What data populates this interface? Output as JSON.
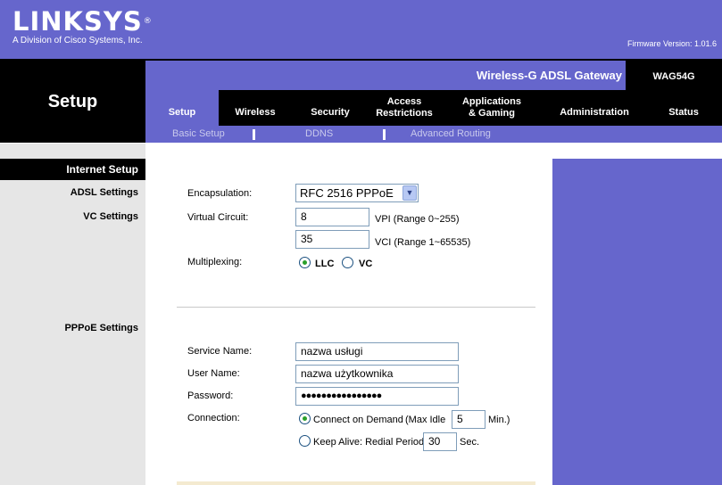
{
  "header": {
    "brand": "LINKSYS",
    "registered": "®",
    "tagline": "A Division of Cisco Systems, Inc.",
    "firmware": "Firmware Version: 1.01.6"
  },
  "product": {
    "name": "Wireless-G ADSL Gateway",
    "model": "WAG54G"
  },
  "section_title": "Setup",
  "tabs": [
    {
      "label": "Setup",
      "active": true
    },
    {
      "label": "Wireless"
    },
    {
      "label": "Security"
    },
    {
      "label": "Access\nRestrictions"
    },
    {
      "label": "Applications\n& Gaming"
    },
    {
      "label": "Administration"
    },
    {
      "label": "Status"
    }
  ],
  "subtabs": [
    "Basic Setup",
    "DDNS",
    "Advanced Routing"
  ],
  "sidebar": {
    "heading": "Internet Setup",
    "items": [
      "ADSL Settings",
      "VC Settings",
      "PPPoE Settings"
    ]
  },
  "form": {
    "encapsulation_label": "Encapsulation:",
    "encapsulation_value": "RFC 2516 PPPoE",
    "virtual_circuit_label": "Virtual Circuit:",
    "vpi_value": "8",
    "vpi_hint": "VPI (Range 0~255)",
    "vci_value": "35",
    "vci_hint": "VCI (Range 1~65535)",
    "multiplexing_label": "Multiplexing:",
    "mux_llc": "LLC",
    "mux_vc": "VC",
    "service_name_label": "Service Name:",
    "service_name_value": "nazwa usługi",
    "user_name_label": "User Name:",
    "user_name_value": "nazwa użytkownika",
    "password_label": "Password:",
    "password_value": "●●●●●●●●●●●●●●●●",
    "connection_label": "Connection:",
    "connect_on_demand": "Connect on Demand",
    "max_idle_label": "(Max Idle",
    "max_idle_value": "5",
    "max_idle_unit": "Min.)",
    "keep_alive": "Keep Alive: Redial Period",
    "redial_value": "30",
    "redial_unit": "Sec."
  },
  "colors": {
    "purple": "#6666cc",
    "black": "#000000",
    "sidebar_gray": "#e6e6e6"
  }
}
